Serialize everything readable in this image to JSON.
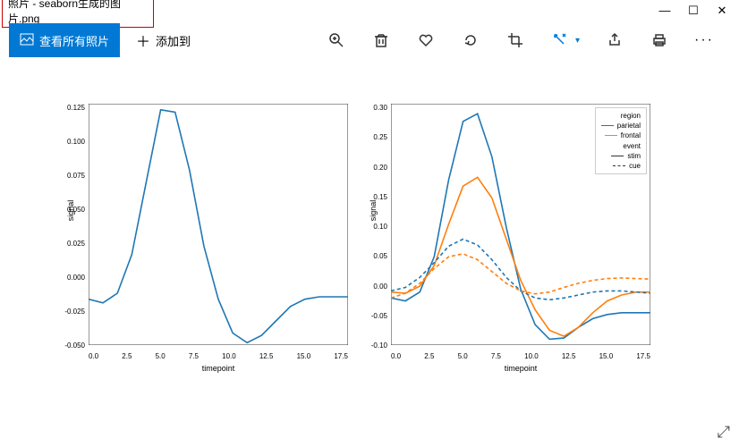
{
  "window": {
    "title": "照片 - seaborn生成的图片.png"
  },
  "toolbar": {
    "view_all": "查看所有照片",
    "add_to": "添加到"
  },
  "chart_data": [
    {
      "type": "line",
      "xlabel": "timepoint",
      "ylabel": "signal",
      "xlim": [
        0,
        18
      ],
      "ylim": [
        -0.06,
        0.14
      ],
      "xticks": [
        "0.0",
        "2.5",
        "5.0",
        "7.5",
        "10.0",
        "12.5",
        "15.0",
        "17.5"
      ],
      "yticks": [
        "0.125",
        "0.100",
        "0.075",
        "0.050",
        "0.025",
        "0.000",
        "-0.025",
        "-0.050"
      ],
      "series": [
        {
          "name": "parietal",
          "color": "#1f77b4",
          "dash": "solid",
          "x": [
            0,
            1,
            2,
            3,
            4,
            5,
            6,
            7,
            8,
            9,
            10,
            11,
            12,
            13,
            14,
            15,
            16,
            17,
            18
          ],
          "y": [
            -0.022,
            -0.025,
            -0.017,
            0.015,
            0.075,
            0.135,
            0.133,
            0.085,
            0.022,
            -0.022,
            -0.05,
            -0.058,
            -0.052,
            -0.04,
            -0.028,
            -0.022,
            -0.02,
            -0.02,
            -0.02
          ]
        }
      ]
    },
    {
      "type": "line",
      "xlabel": "timepoint",
      "ylabel": "signal",
      "xlim": [
        0,
        18
      ],
      "ylim": [
        -0.11,
        0.3
      ],
      "xticks": [
        "0.0",
        "2.5",
        "5.0",
        "7.5",
        "10.0",
        "12.5",
        "15.0",
        "17.5"
      ],
      "yticks": [
        "0.30",
        "0.25",
        "0.20",
        "0.15",
        "0.10",
        "0.05",
        "0.00",
        "-0.05",
        "-0.10"
      ],
      "legend": {
        "groups": [
          {
            "title": "region",
            "items": [
              {
                "name": "parietal",
                "color": "#1f77b4",
                "dash": "solid"
              },
              {
                "name": "frontal",
                "color": "#ff7f0e",
                "dash": "solid"
              }
            ]
          },
          {
            "title": "event",
            "items": [
              {
                "name": "stim",
                "color": "#333333",
                "dash": "solid"
              },
              {
                "name": "cue",
                "color": "#333333",
                "dash": "dashed"
              }
            ]
          }
        ]
      },
      "series": [
        {
          "name": "parietal-stim",
          "color": "#1f77b4",
          "dash": "solid",
          "x": [
            0,
            1,
            2,
            3,
            4,
            5,
            6,
            7,
            8,
            9,
            10,
            11,
            12,
            13,
            14,
            15,
            16,
            17,
            18
          ],
          "y": [
            -0.03,
            -0.035,
            -0.02,
            0.04,
            0.17,
            0.27,
            0.283,
            0.21,
            0.09,
            -0.015,
            -0.075,
            -0.1,
            -0.098,
            -0.08,
            -0.065,
            -0.058,
            -0.055,
            -0.055,
            -0.055
          ]
        },
        {
          "name": "frontal-stim",
          "color": "#ff7f0e",
          "dash": "solid",
          "x": [
            0,
            1,
            2,
            3,
            4,
            5,
            6,
            7,
            8,
            9,
            10,
            11,
            12,
            13,
            14,
            15,
            16,
            17,
            18
          ],
          "y": [
            -0.02,
            -0.022,
            -0.01,
            0.025,
            0.095,
            0.16,
            0.175,
            0.14,
            0.07,
            0.0,
            -0.05,
            -0.085,
            -0.095,
            -0.08,
            -0.055,
            -0.035,
            -0.025,
            -0.02,
            -0.02
          ]
        },
        {
          "name": "parietal-cue",
          "color": "#1f77b4",
          "dash": "dashed",
          "x": [
            0,
            1,
            2,
            3,
            4,
            5,
            6,
            7,
            8,
            9,
            10,
            11,
            12,
            13,
            14,
            15,
            16,
            17,
            18
          ],
          "y": [
            -0.018,
            -0.012,
            0.005,
            0.03,
            0.058,
            0.07,
            0.06,
            0.035,
            0.005,
            -0.018,
            -0.03,
            -0.033,
            -0.03,
            -0.025,
            -0.02,
            -0.018,
            -0.018,
            -0.02,
            -0.022
          ]
        },
        {
          "name": "frontal-cue",
          "color": "#ff7f0e",
          "dash": "dashed",
          "x": [
            0,
            1,
            2,
            3,
            4,
            5,
            6,
            7,
            8,
            9,
            10,
            11,
            12,
            13,
            14,
            15,
            16,
            17,
            18
          ],
          "y": [
            -0.03,
            -0.022,
            -0.005,
            0.02,
            0.04,
            0.045,
            0.035,
            0.015,
            -0.005,
            -0.018,
            -0.023,
            -0.02,
            -0.012,
            -0.005,
            0.0,
            0.003,
            0.004,
            0.003,
            0.002
          ]
        }
      ]
    }
  ]
}
